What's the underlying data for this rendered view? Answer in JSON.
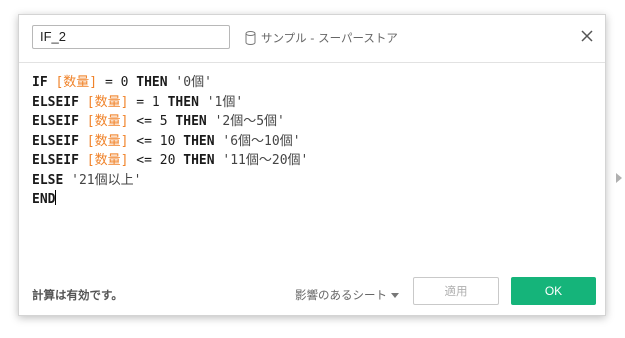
{
  "dialog": {
    "calc_name": "IF_2",
    "datasource": {
      "icon": "database-icon",
      "label": "サンプル - スーパーストア"
    },
    "close_icon": "close-icon"
  },
  "editor": {
    "lines": [
      [
        {
          "t": "kw",
          "v": "IF "
        },
        {
          "t": "field",
          "v": "[数量]"
        },
        {
          "t": "op",
          "v": " = 0 "
        },
        {
          "t": "kw",
          "v": "THEN "
        },
        {
          "t": "str",
          "v": "'0個'"
        }
      ],
      [
        {
          "t": "kw",
          "v": "ELSEIF "
        },
        {
          "t": "field",
          "v": "[数量]"
        },
        {
          "t": "op",
          "v": " = 1 "
        },
        {
          "t": "kw",
          "v": "THEN "
        },
        {
          "t": "str",
          "v": "'1個'"
        }
      ],
      [
        {
          "t": "kw",
          "v": "ELSEIF "
        },
        {
          "t": "field",
          "v": "[数量]"
        },
        {
          "t": "op",
          "v": " <= 5 "
        },
        {
          "t": "kw",
          "v": "THEN "
        },
        {
          "t": "str",
          "v": "'2個～5個'"
        }
      ],
      [
        {
          "t": "kw",
          "v": "ELSEIF "
        },
        {
          "t": "field",
          "v": "[数量]"
        },
        {
          "t": "op",
          "v": " <= 10 "
        },
        {
          "t": "kw",
          "v": "THEN "
        },
        {
          "t": "str",
          "v": "'6個～10個'"
        }
      ],
      [
        {
          "t": "kw",
          "v": "ELSEIF "
        },
        {
          "t": "field",
          "v": "[数量]"
        },
        {
          "t": "op",
          "v": " <= 20 "
        },
        {
          "t": "kw",
          "v": "THEN "
        },
        {
          "t": "str",
          "v": "'11個～20個'"
        }
      ],
      [
        {
          "t": "kw",
          "v": "ELSE "
        },
        {
          "t": "str",
          "v": "'21個以上'"
        }
      ],
      [
        {
          "t": "kw",
          "v": "END"
        }
      ]
    ]
  },
  "footer": {
    "status": "計算は有効です。",
    "affected_sheets": "影響のあるシート",
    "apply_label": "適用",
    "ok_label": "OK"
  },
  "colors": {
    "field": "#f0832a",
    "ok_button": "#15b47a"
  }
}
